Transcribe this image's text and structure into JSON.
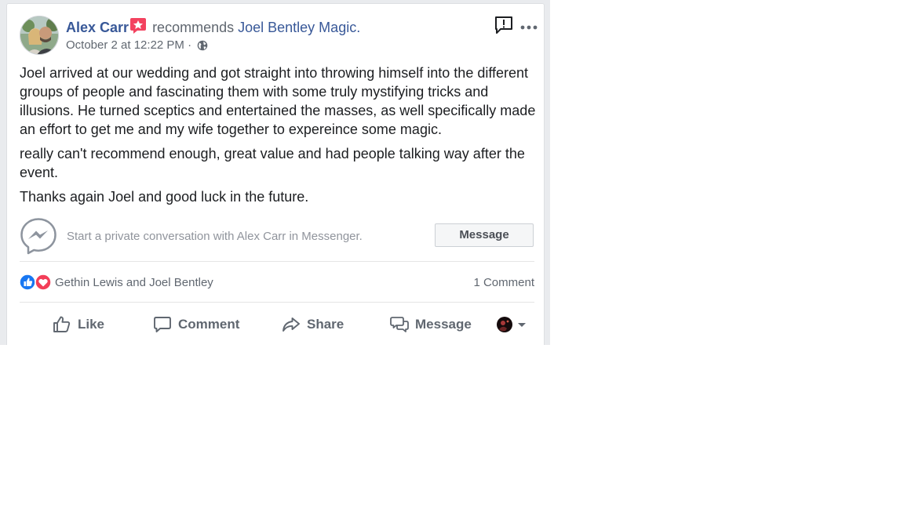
{
  "post": {
    "author_name": "Alex Carr",
    "recommends_text": "recommends",
    "page_name": "Joel Bentley Magic.",
    "timestamp": "October 2 at 12:22 PM",
    "separator": "·",
    "privacy_icon": "globe-icon",
    "body_paragraphs": [
      "Joel arrived at our wedding and got straight into throwing himself into the different groups of people and fascinating them with some truly mystifying tricks and illusions. He turned sceptics and entertained the masses, as well specifically made an effort to get me and my wife together to expereince some magic.",
      "really can't recommend enough, great value and had people talking way after the event.",
      "Thanks again Joel and good luck in the future."
    ]
  },
  "messenger": {
    "prompt": "Start a private conversation with Alex Carr in Messenger.",
    "button_label": "Message"
  },
  "reactions": {
    "names": "Gethin Lewis and Joel Bentley",
    "comment_count": "1 Comment"
  },
  "actions": {
    "like": "Like",
    "comment": "Comment",
    "share": "Share",
    "message": "Message"
  },
  "colors": {
    "link": "#385898",
    "secondary_text": "#606770",
    "like_blue": "#1877f2",
    "love_red": "#f33e58",
    "recommend_pink": "#f3425f"
  }
}
